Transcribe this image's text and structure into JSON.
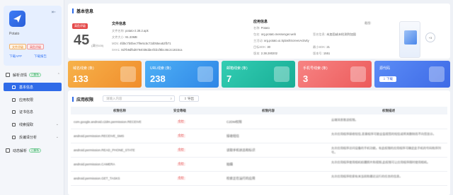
{
  "sidebar": {
    "app_name": "Potato",
    "tags": [
      "文件评级",
      "高危评级"
    ],
    "downloads": [
      "下载APP",
      "下载报告"
    ],
    "group1": {
      "label": "解析详情",
      "badge": "已解析"
    },
    "items": [
      {
        "label": "基本信息",
        "active": true
      },
      {
        "label": "应用权限",
        "active": false
      },
      {
        "label": "证书信息",
        "active": false
      },
      {
        "label": "线索提取",
        "active": false
      },
      {
        "label": "反编译分析",
        "active": false
      }
    ],
    "group2": {
      "label": "动态解析",
      "badge": "已解析"
    }
  },
  "basic": {
    "title": "基本信息",
    "risk_badge": "高危评级",
    "score": "45",
    "score_sub": "(满分100)",
    "file_info": {
      "title": "文件信息",
      "rows": [
        {
          "k": "文件名称:",
          "v": "potato-2.38.2.apk"
        },
        {
          "k": "文件大小:",
          "v": "91.33MB"
        },
        {
          "k": "MD5:",
          "v": "4fd5c7b0bec7f9e5c5c72d055ea52fb71"
        },
        {
          "k": "SHA1:",
          "v": "8d7b9df5d6794038dde4fcb1f8bc46c2c1615ca"
        }
      ]
    },
    "app_info": {
      "title": "应用信息",
      "rows": [
        {
          "k": "名称:",
          "v": "Potato"
        },
        {
          "k": "包名:",
          "v": "org.potato.messenger.web",
          "k2": "签名信息:",
          "v2": "未加固或未检测到加固"
        },
        {
          "k": "主活动:",
          "v": "org.potato.ui.SplashScreenActivity"
        },
        {
          "k": "目标SDK:",
          "v": "30",
          "k2": "最小SDK:",
          "v2": "21"
        },
        {
          "k": "版本:",
          "v": "2.38.280202",
          "k2": "版本号:",
          "v2": "1551"
        }
      ]
    },
    "screenshot_label": "截图:",
    "plus_label": "+3"
  },
  "cards": [
    {
      "label": "域名线索 (条)",
      "value": "133",
      "color": "#f5a13a"
    },
    {
      "label": "URL线索 (条)",
      "value": "238",
      "color": "#3b9ef0"
    },
    {
      "label": "邮箱线索 (条)",
      "value": "7",
      "color": "#22bfa6"
    },
    {
      "label": "手机号线索 (条)",
      "value": "3",
      "color": "#f06a6a"
    },
    {
      "label": "源代码",
      "button": "下载",
      "color": "#4f7ef0"
    }
  ],
  "permissions": {
    "title": "应用权限",
    "search_placeholder": "请输入内容",
    "export_label": "导出",
    "columns": [
      "权限名称",
      "安全等级",
      "权限内容",
      "权限描述"
    ],
    "rows": [
      {
        "name": "com.google.android.c2dm.permission.RECEIVE",
        "level": "危险",
        "content": "C2DM权限",
        "desc": "云端消息推送权限。"
      },
      {
        "name": "android.permission.RECEIVE_SMS",
        "level": "危险",
        "content": "接收短信",
        "desc": "允许应用程序接收短信,恶意程序可能会监视您的短信或将其删除而不向您显示。"
      },
      {
        "name": "android.permission.READ_PHONE_STATE",
        "level": "危险",
        "content": "读取手机状态和标识",
        "desc": "允许应用程序访问设备的手机功能。有此权限的应用程序可确定此手机的号码和序列号。"
      },
      {
        "name": "android.permission.CAMERA",
        "level": "危险",
        "content": "拍摄",
        "desc": "允许应用程序使用相机拍摄照片和视频,此权限可让应用程序随时使用相机。"
      },
      {
        "name": "android.permission.GET_TASKS",
        "level": "危险",
        "content": "检索正在运行的应用",
        "desc": "允许应用程序检索有关当前和最近运行的任务的信息。"
      }
    ]
  }
}
